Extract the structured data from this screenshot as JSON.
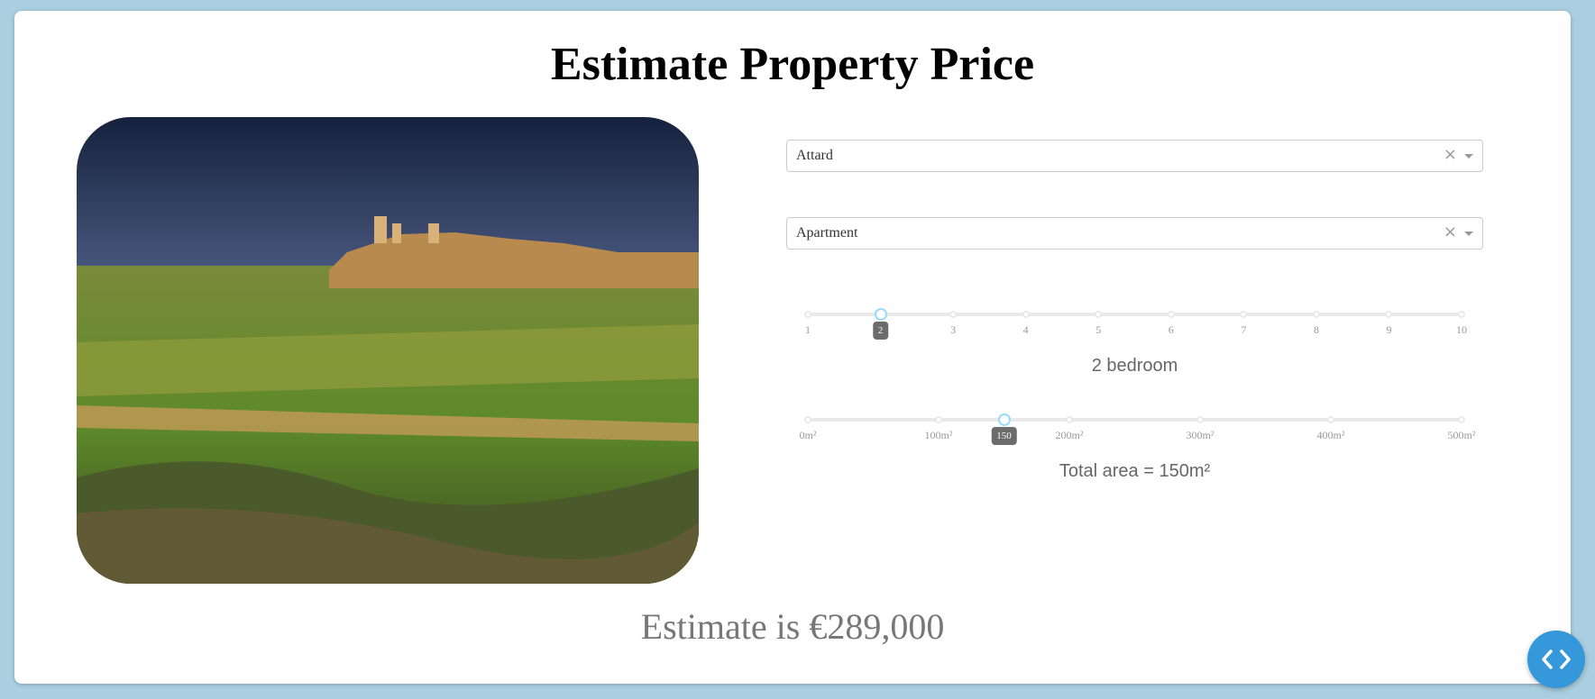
{
  "page": {
    "title": "Estimate Property Price"
  },
  "photo": {
    "alt": ""
  },
  "locality_select": {
    "value": "Attard",
    "clear": "×"
  },
  "type_select": {
    "value": "Apartment",
    "clear": "×"
  },
  "bedroom_slider": {
    "min": 1,
    "max": 10,
    "value": 2,
    "marks": [
      "1",
      "2",
      "3",
      "4",
      "5",
      "6",
      "7",
      "8",
      "9",
      "10"
    ],
    "tooltip": "2",
    "caption": "2 bedroom"
  },
  "area_slider": {
    "min": 0,
    "max": 500,
    "value": 150,
    "marks": [
      {
        "v": 0,
        "label": "0m²"
      },
      {
        "v": 100,
        "label": "100m²"
      },
      {
        "v": 200,
        "label": "200m²"
      },
      {
        "v": 300,
        "label": "300m²"
      },
      {
        "v": 400,
        "label": "400m²"
      },
      {
        "v": 500,
        "label": "500m²"
      }
    ],
    "tooltip": "150",
    "caption": "Total area = 150m²"
  },
  "estimate": {
    "text": "Estimate is €289,000"
  },
  "colors": {
    "accent": "#96dbfa",
    "fab": "#3498db",
    "background": "#a9cfe0"
  },
  "icons": {
    "fab": "code-icon"
  }
}
